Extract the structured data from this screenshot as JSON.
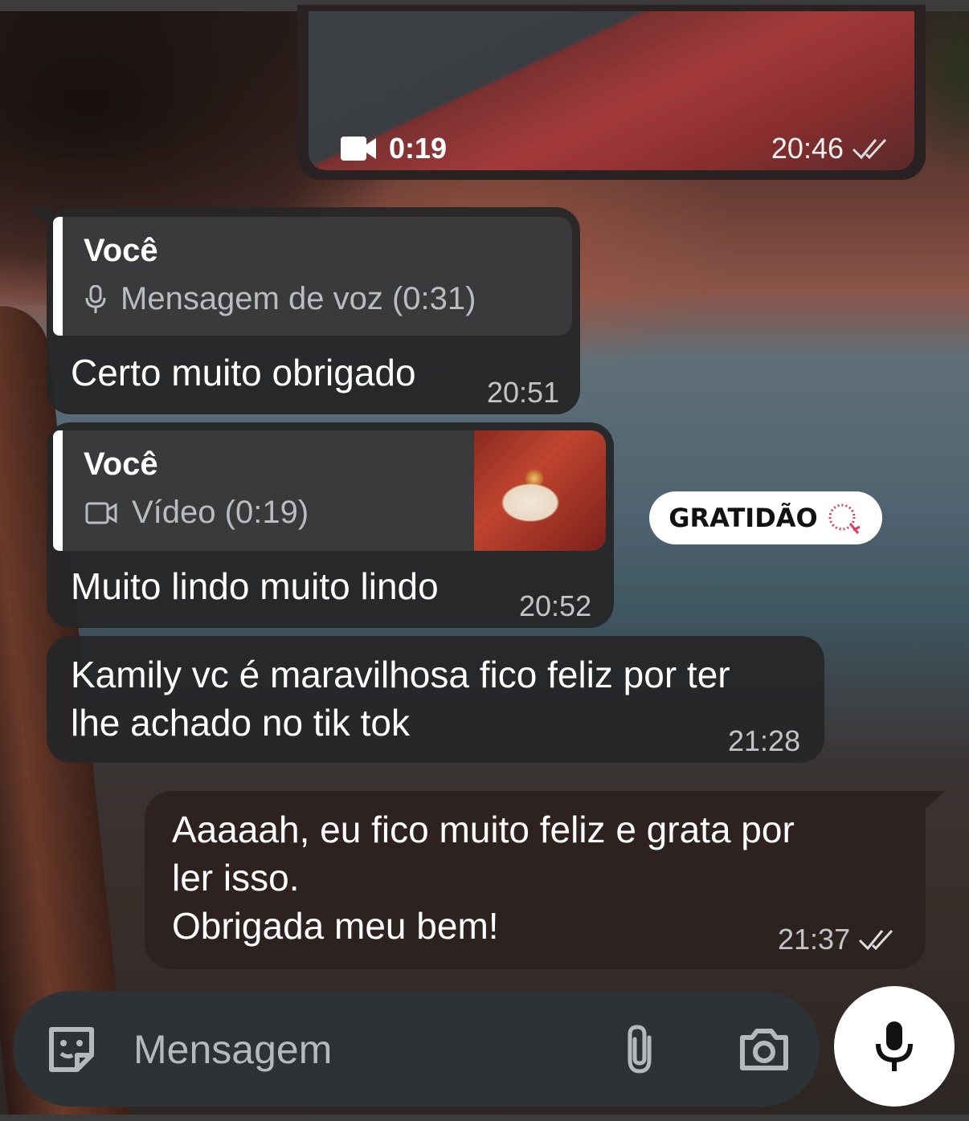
{
  "video_message": {
    "duration": "0:19",
    "time": "20:46",
    "icon": "video-camera-icon",
    "status_icon": "double-check-icon"
  },
  "messages": [
    {
      "reply": {
        "author": "Você",
        "label": "Mensagem de voz (0:31)",
        "icon": "microphone-icon"
      },
      "text": "Certo muito obrigado",
      "time": "20:51"
    },
    {
      "reply": {
        "author": "Você",
        "label": "Vídeo (0:19)",
        "icon": "video-icon"
      },
      "text": "Muito lindo muito lindo",
      "time": "20:52"
    },
    {
      "text_line1": "Kamily vc é maravilhosa fico feliz por ter",
      "text_line2": "lhe achado no tik tok",
      "time": "21:28"
    }
  ],
  "sticker": {
    "text": "GRATIDÃO"
  },
  "outgoing": {
    "line1": "Aaaaah, eu fico muito feliz e grata por",
    "line2": "ler isso.",
    "line3": "Obrigada meu bem!",
    "time": "21:37",
    "status_icon": "double-check-icon"
  },
  "composer": {
    "placeholder": "Mensagem",
    "icons": [
      "sticker-icon",
      "paperclip-icon",
      "camera-icon",
      "microphone-icon"
    ]
  },
  "colors": {
    "bubble_in": "#262628",
    "bubble_out": "#2c2220",
    "reply_bar": "#ffffff",
    "input_bar": "#2c3236"
  }
}
